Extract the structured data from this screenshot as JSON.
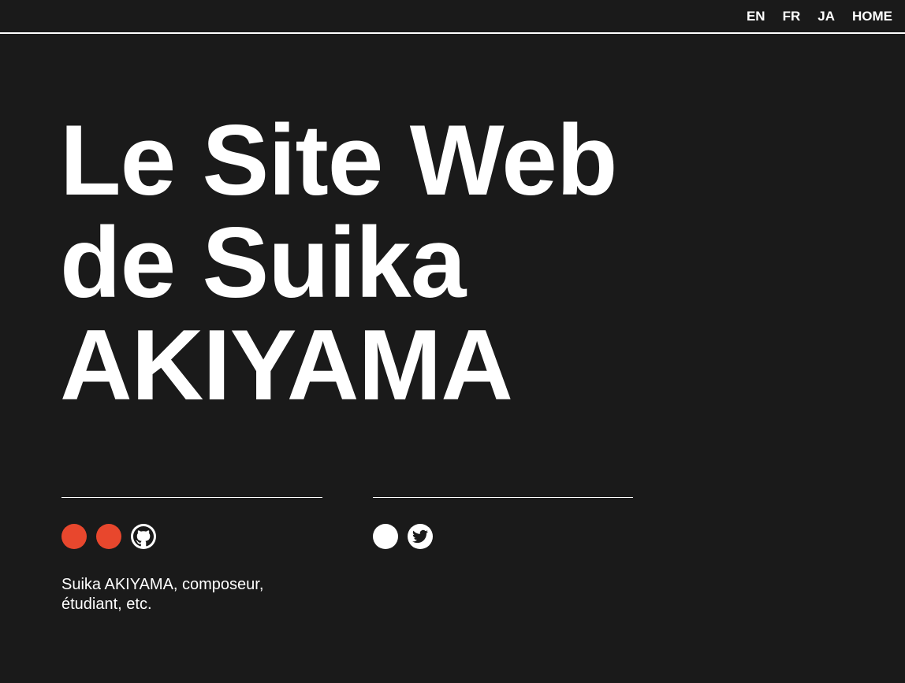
{
  "nav": {
    "items": [
      {
        "label": "EN"
      },
      {
        "label": "FR"
      },
      {
        "label": "JA"
      },
      {
        "label": "HOME"
      }
    ]
  },
  "hero": {
    "line1": "Le Site Web",
    "line2": "de Suika",
    "line3": "AKIYAMA"
  },
  "left_column": {
    "icons": [
      {
        "name": "red-circle-icon",
        "color": "#e8472d"
      },
      {
        "name": "red-circle-icon",
        "color": "#e8472d"
      },
      {
        "name": "github-icon",
        "color": "#ffffff"
      }
    ],
    "description": "Suika AKIYAMA, composeur, étudiant, etc."
  },
  "right_column": {
    "icons": [
      {
        "name": "white-circle-icon",
        "color": "#ffffff"
      },
      {
        "name": "twitter-icon",
        "color": "#ffffff"
      }
    ]
  },
  "colors": {
    "background": "#1a1a1a",
    "text": "#ffffff",
    "accent": "#e8472d"
  }
}
